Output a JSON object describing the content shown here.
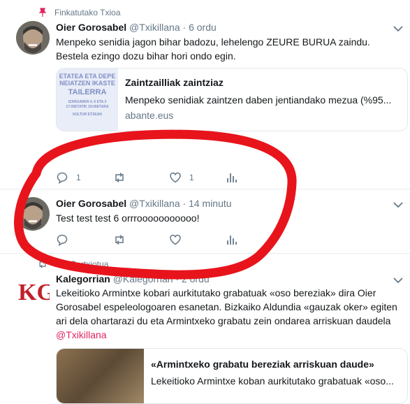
{
  "tweets": [
    {
      "context": "Finkatutako Txioa",
      "name": "Oier Gorosabel",
      "handle": "@Txikillana",
      "time": "· 6 ordu",
      "text": "Menpeko senidia jagon bihar badozu, lehelengo ZEURE BURUA zaindu. Bestela ezingo dozu bihar hori ondo egin.",
      "card": {
        "title": "Zaintzailliak zaintziaz",
        "description": "Menpeko senidiak zaintzen daben jentiandako mezua (%95...",
        "domain": "abante.eus",
        "thumb_lines": [
          "ETATEA ETA DEPE",
          "NEIATZEN IKASTE",
          "TAILERRA",
          "IZARGAREN 4, 6 ETA 3",
          "17:00ETATIK 19:00ETARA",
          "KULTUR ETXEAN"
        ]
      },
      "actions": {
        "reply_count": "1",
        "retweet_count": "",
        "like_count": "1"
      }
    },
    {
      "name": "Oier Gorosabel",
      "handle": "@Txikillana",
      "time": "· 14 minutu",
      "text": "Test test test 6 orrrooooooooooo!",
      "actions": {
        "reply_count": "",
        "retweet_count": "",
        "like_count": ""
      }
    },
    {
      "context": "Zuk Bertxiotua",
      "name": "Kalegorrian",
      "handle": "@Kalegorrian",
      "time": "· 2 ordu",
      "text": "Lekeitioko Armintxe kobari aurkitutako grabatuak «oso bereziak» dira Oier Gorosabel espeleologoaren esanetan. Bizkaiko Aldundia «gauzak oker» egiten ari dela ohartarazi du eta Armintxeko grabatu zein ondarea arriskuan daudela",
      "mention": "@Txikillana",
      "logo_text": "KG",
      "card": {
        "title": "«Armintxeko grabatu bereziak arriskuan daude»",
        "description": "Lekeitioko Armintxe koban aurkitutako grabatuak «oso..."
      }
    }
  ],
  "colors": {
    "accent": "#e0245e",
    "muted": "#657786",
    "text": "#14171a",
    "annotation": "#e8141c"
  }
}
